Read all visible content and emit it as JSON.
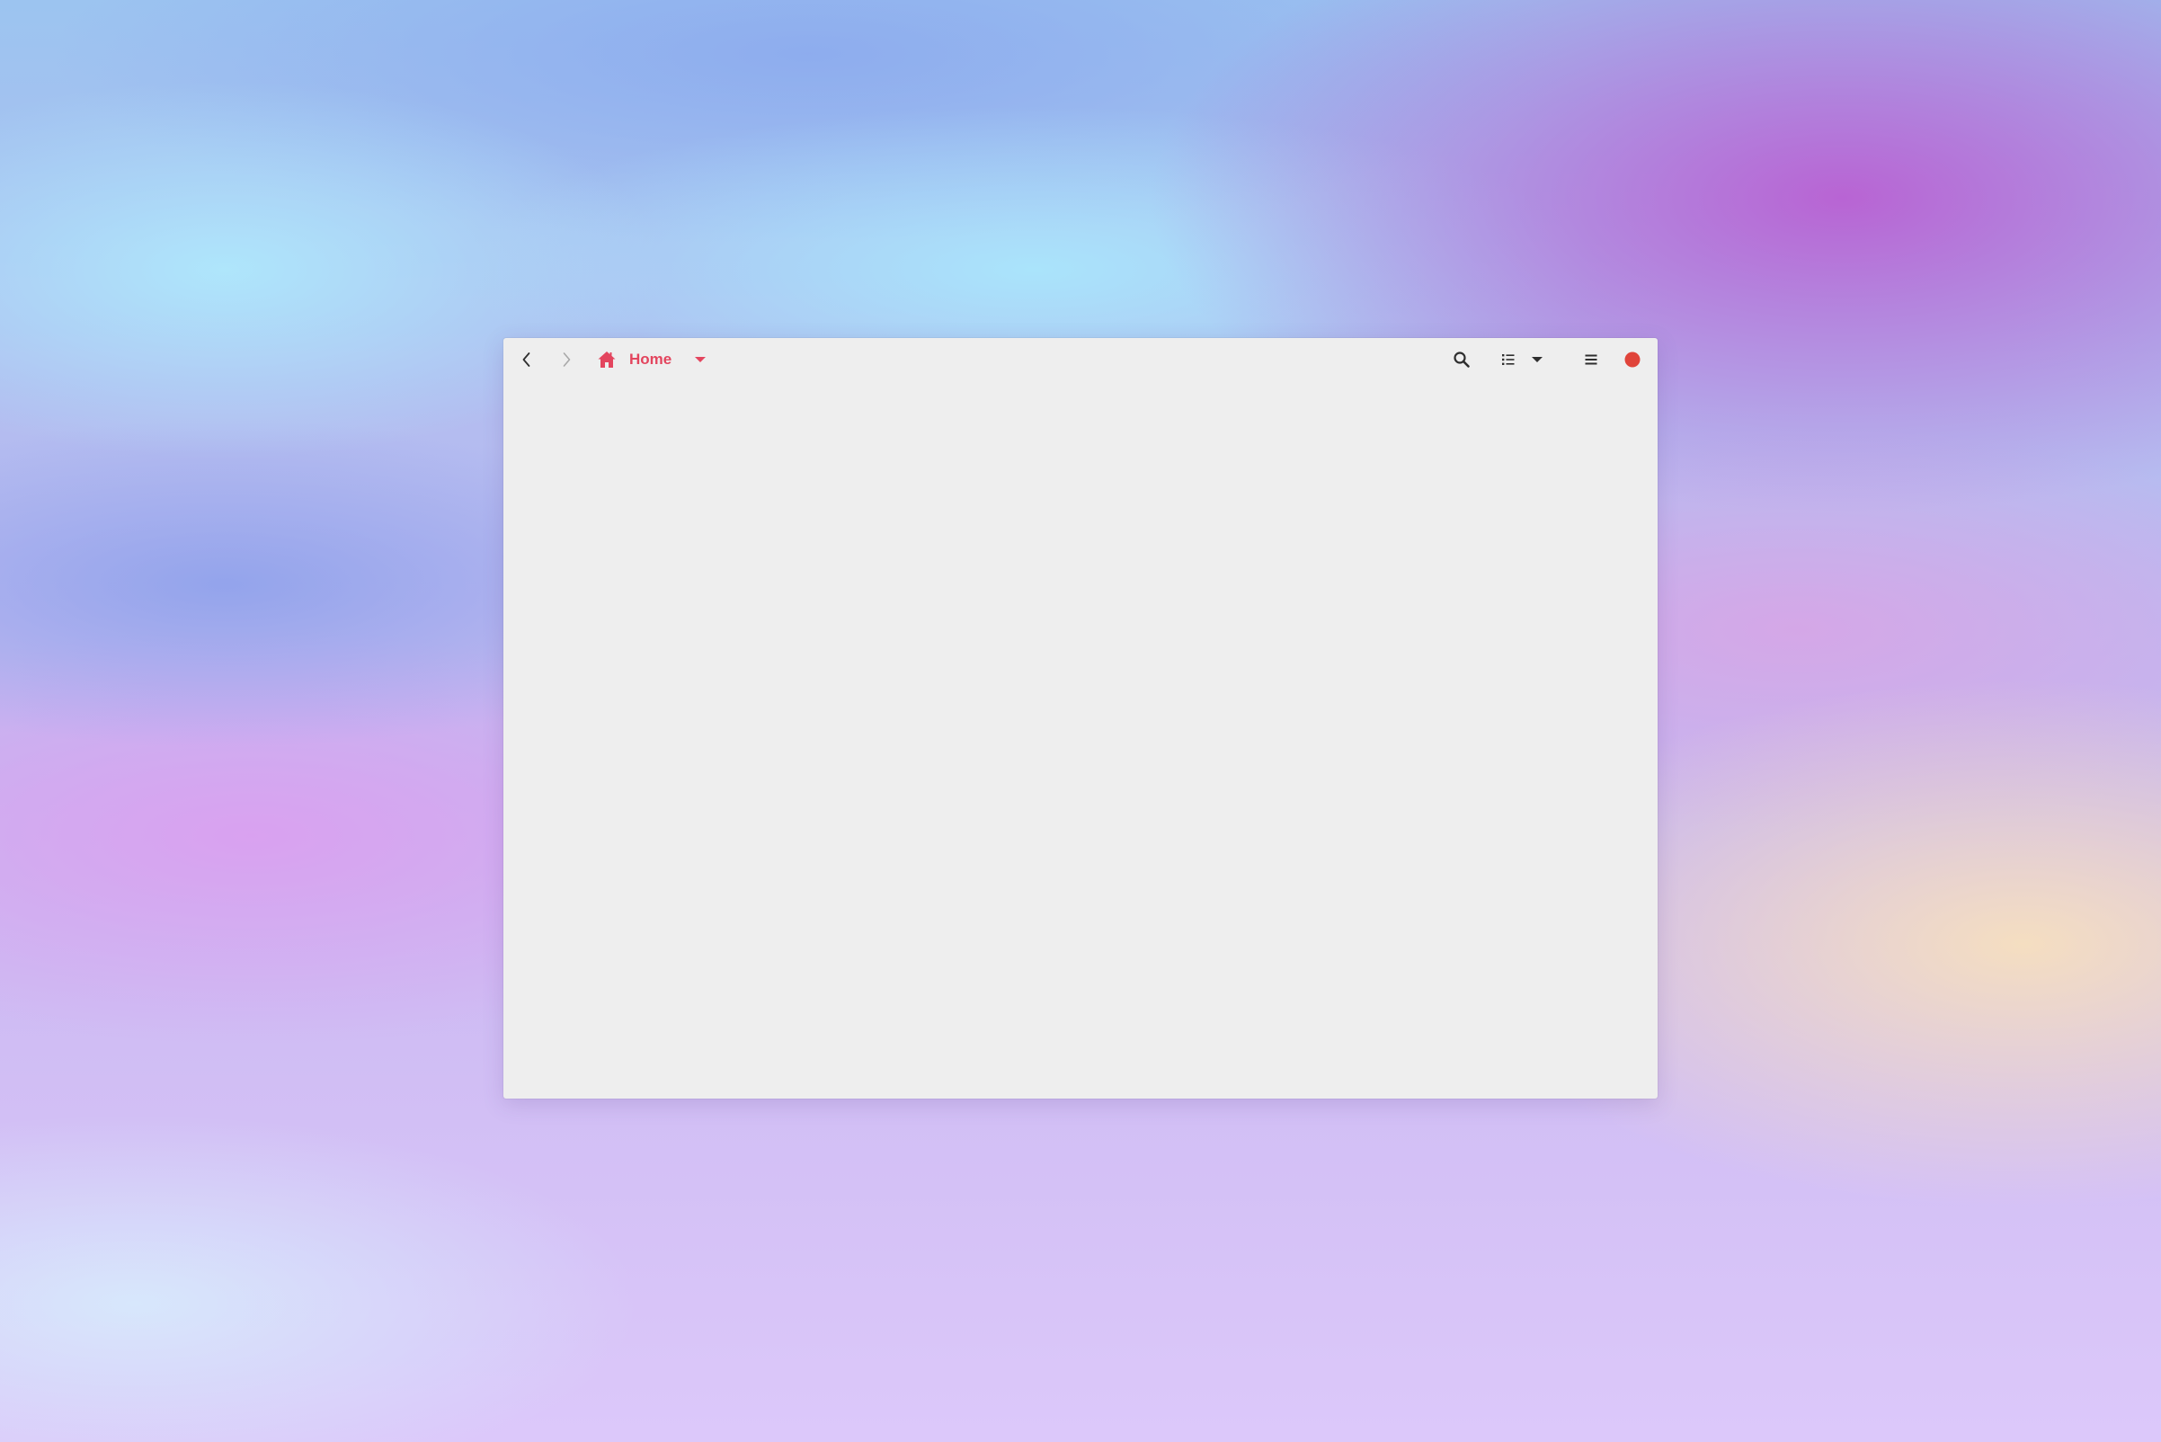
{
  "window": {
    "title": "Home"
  },
  "headerbar": {
    "back_icon": "chevron-left-icon",
    "forward_icon": "chevron-right-icon",
    "path": {
      "icon": "home-icon",
      "label": "Home",
      "dropdown_icon": "triangle-down-icon"
    },
    "search_icon": "search-icon",
    "view_icon": "view-list-icon",
    "view_dropdown_icon": "triangle-down-icon",
    "menu_icon": "hamburger-menu-icon",
    "close_icon": "close-dot-icon"
  },
  "colors": {
    "accent": "#e3455e",
    "close": "#e0443a",
    "window_bg": "#eeeeee",
    "icon_dark": "#2e2e2e",
    "icon_disabled": "#a8a8a8"
  }
}
